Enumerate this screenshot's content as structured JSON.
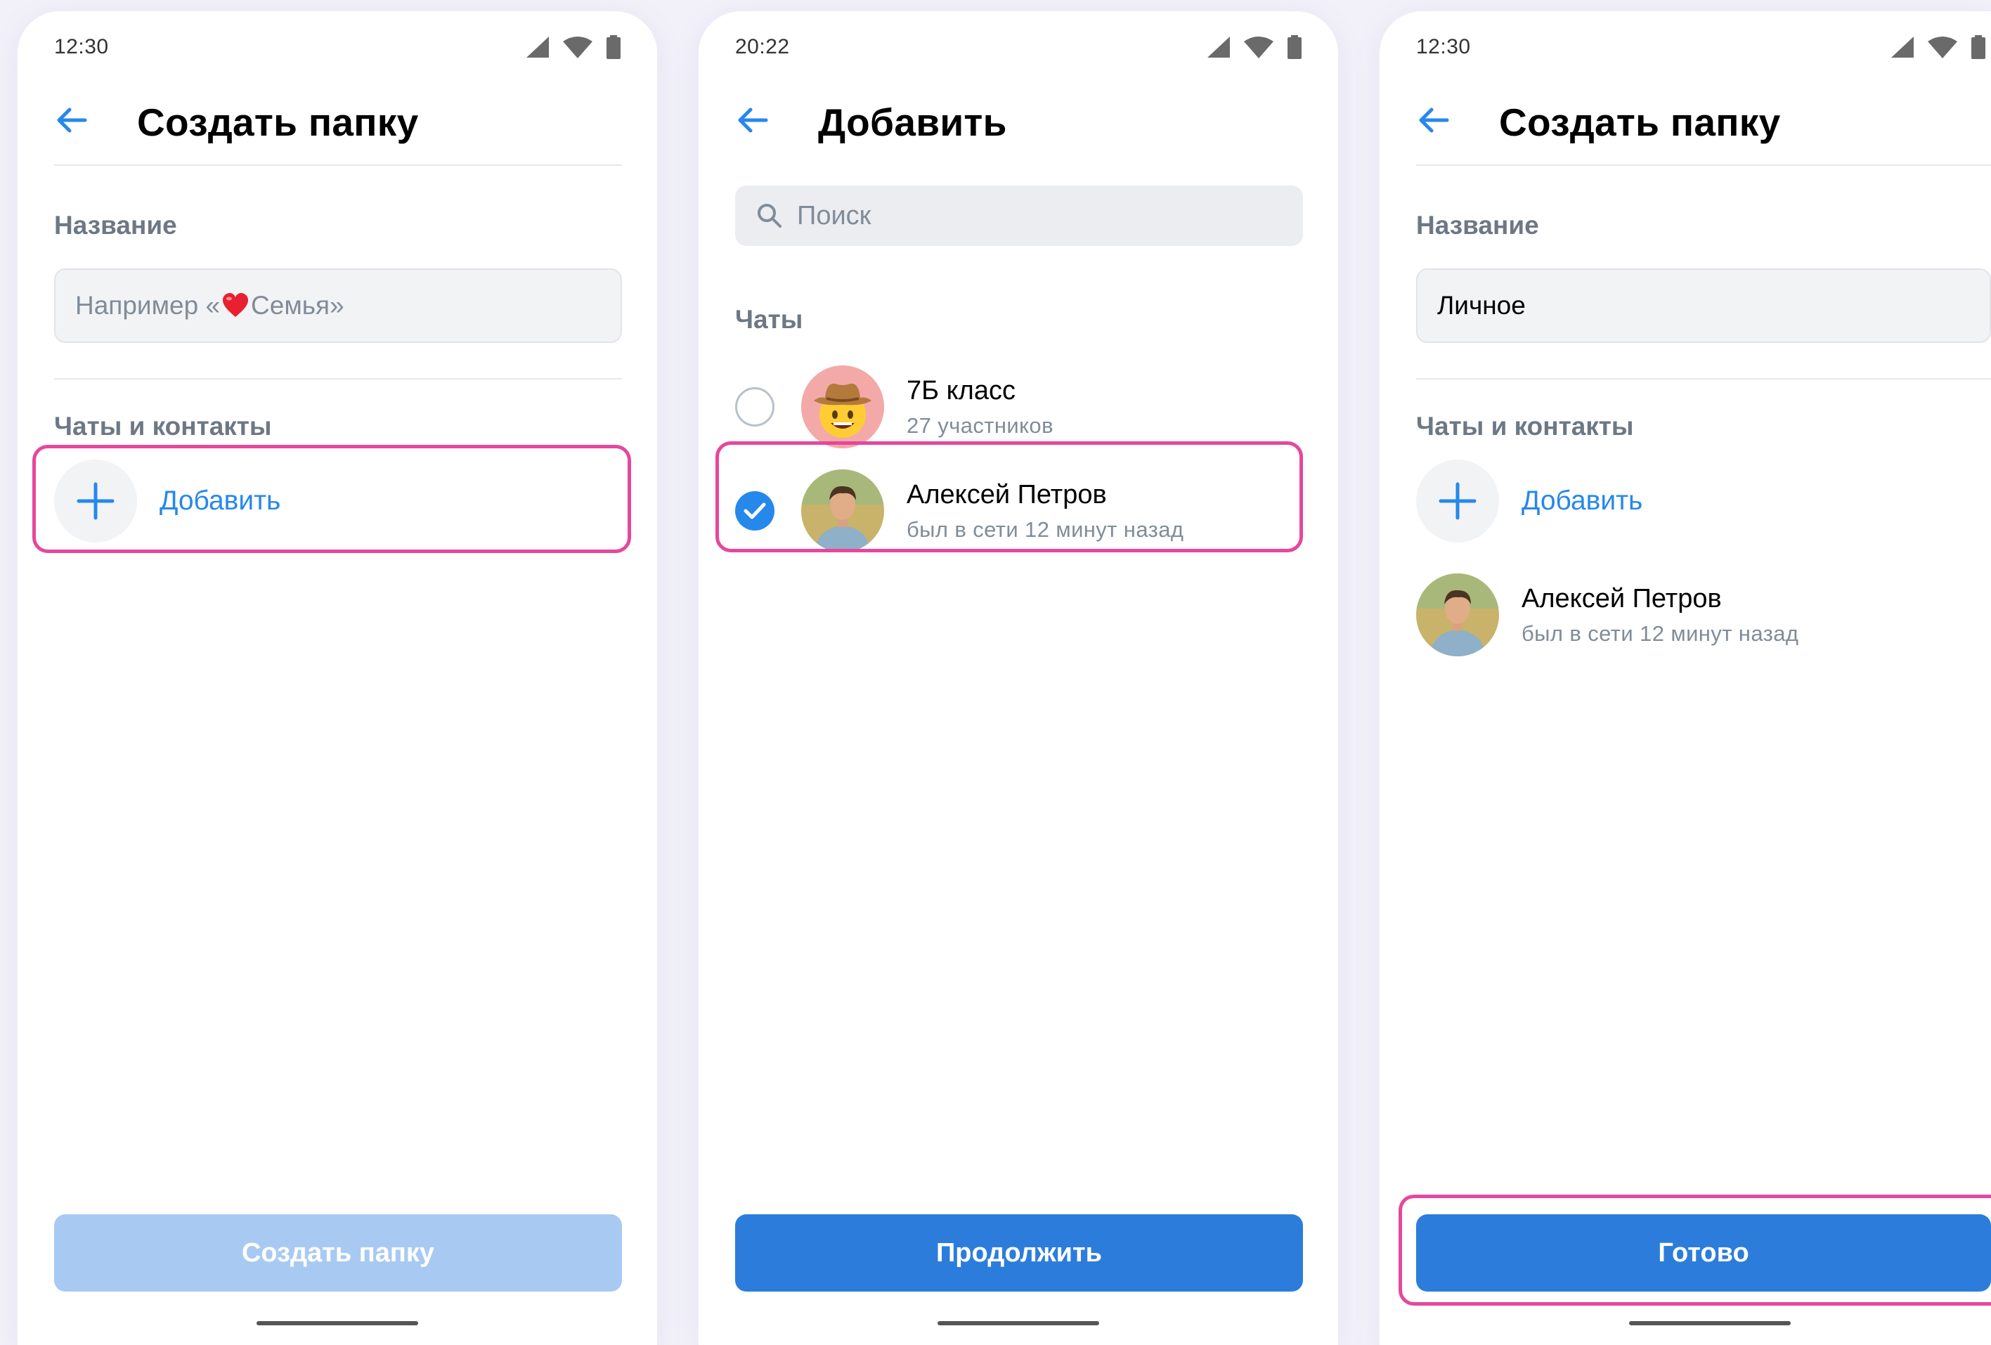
{
  "colors": {
    "accent": "#2688eb",
    "button_active": "#2c7ddb",
    "button_disabled": "#a8caf2",
    "highlight": "#e6479c"
  },
  "screen1": {
    "time": "12:30",
    "title": "Создать папку",
    "name_label": "Название",
    "name_placeholder": "Например «",
    "name_placeholder_tail": " Семья»",
    "contacts_label": "Чаты и контакты",
    "add_label": "Добавить",
    "create_button": "Создать папку"
  },
  "screen2": {
    "time": "20:22",
    "title": "Добавить",
    "search_placeholder": "Поиск",
    "chats_label": "Чаты",
    "chats": [
      {
        "name": "7Б класс",
        "sub": "27 участников",
        "selected": false,
        "avatar_icon": "cowboy-emoji-icon"
      },
      {
        "name": "Алексей Петров",
        "sub": "был в сети 12 минут назад",
        "selected": true,
        "avatar_icon": "person-photo"
      }
    ],
    "continue_button": "Продолжить"
  },
  "screen3": {
    "time": "12:30",
    "title": "Создать папку",
    "name_label": "Название",
    "name_value": "Личное",
    "contacts_label": "Чаты и контакты",
    "add_label": "Добавить",
    "contact": {
      "name": "Алексей Петров",
      "sub": "был в сети 12 минут назад"
    },
    "done_button": "Готово"
  }
}
